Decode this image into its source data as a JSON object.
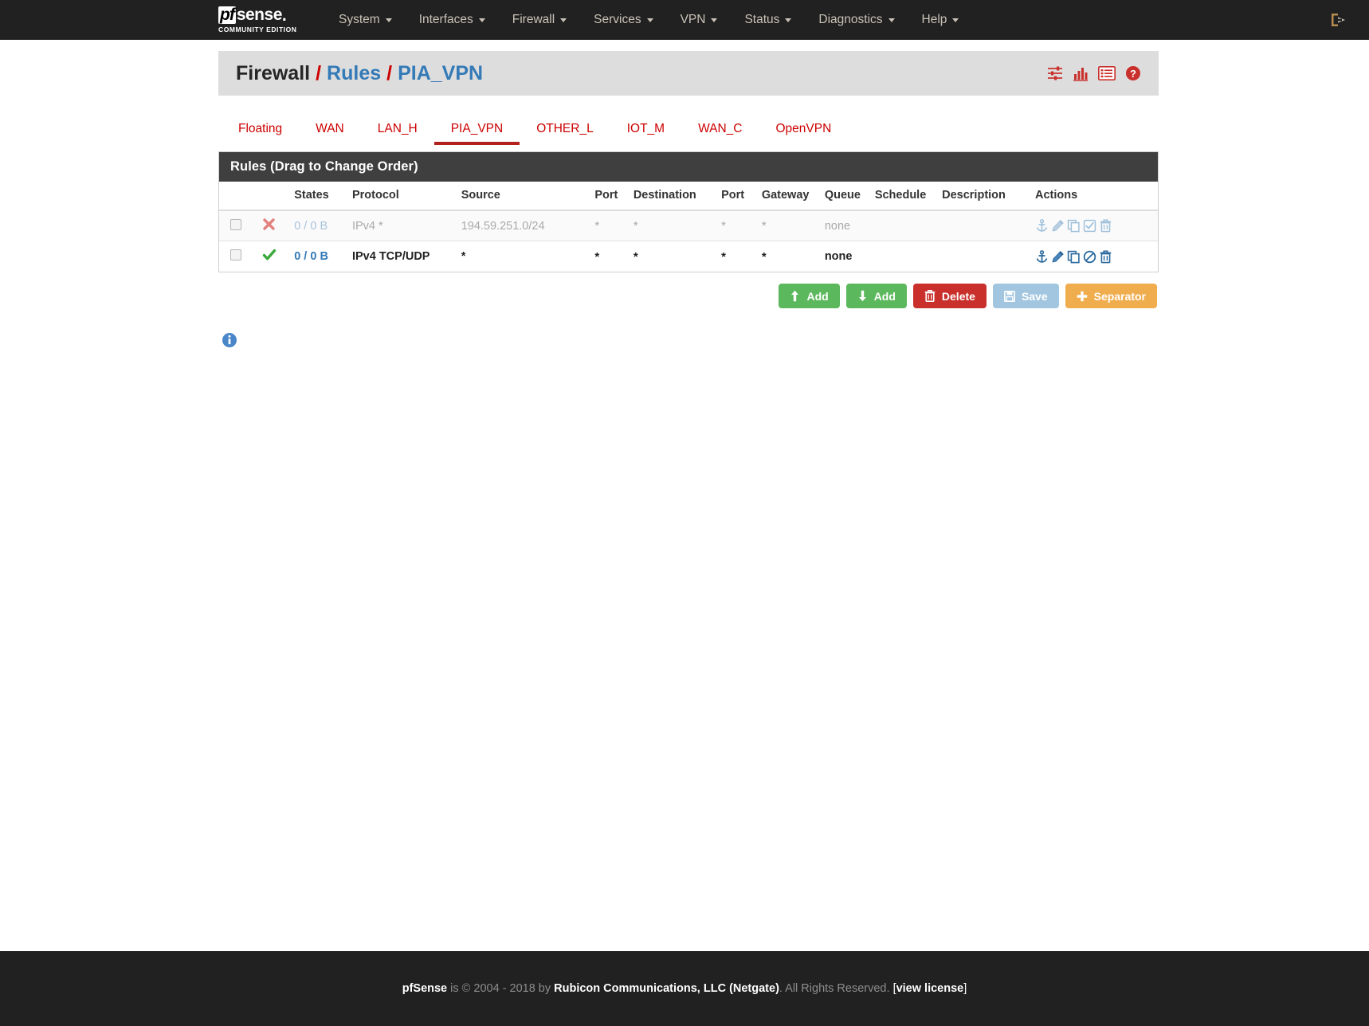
{
  "navbar": {
    "brand": {
      "logo_pf": "pf",
      "logo_sense": "sense",
      "logo_dot": ".",
      "edition": "COMMUNITY EDITION"
    },
    "menu": [
      {
        "label": "System",
        "has_caret": true
      },
      {
        "label": "Interfaces",
        "has_caret": true
      },
      {
        "label": "Firewall",
        "has_caret": true
      },
      {
        "label": "Services",
        "has_caret": true
      },
      {
        "label": "VPN",
        "has_caret": true
      },
      {
        "label": "Status",
        "has_caret": true
      },
      {
        "label": "Diagnostics",
        "has_caret": true
      },
      {
        "label": "Help",
        "has_caret": true
      }
    ],
    "logout_icon": "logout-icon"
  },
  "header": {
    "breadcrumb": {
      "root": "Firewall",
      "sep1": "/",
      "section": "Rules",
      "sep2": "/",
      "current": "PIA_VPN"
    },
    "icons": [
      {
        "name": "filter-sliders-icon"
      },
      {
        "name": "bar-chart-icon"
      },
      {
        "name": "list-table-icon"
      },
      {
        "name": "help-circle-icon"
      }
    ]
  },
  "tabs": [
    {
      "label": "Floating",
      "active": false
    },
    {
      "label": "WAN",
      "active": false
    },
    {
      "label": "LAN_H",
      "active": false
    },
    {
      "label": "PIA_VPN",
      "active": true
    },
    {
      "label": "OTHER_L",
      "active": false
    },
    {
      "label": "IOT_M",
      "active": false
    },
    {
      "label": "WAN_C",
      "active": false
    },
    {
      "label": "OpenVPN",
      "active": false
    }
  ],
  "panel": {
    "title": "Rules (Drag to Change Order)",
    "columns": {
      "checkbox": "",
      "action": "",
      "states": "States",
      "protocol": "Protocol",
      "source": "Source",
      "port": "Port",
      "destination": "Destination",
      "port2": "Port",
      "gateway": "Gateway",
      "queue": "Queue",
      "schedule": "Schedule",
      "description": "Description",
      "actions": "Actions"
    },
    "rows": [
      {
        "enabled": false,
        "action_icon": "block-x-icon",
        "states": "0 / 0 B",
        "protocol": "IPv4 *",
        "source": "194.59.251.0/24",
        "port": "*",
        "destination": "*",
        "port2": "*",
        "gateway": "*",
        "queue": "none",
        "schedule": "",
        "description": "",
        "actions": [
          {
            "name": "anchor-icon"
          },
          {
            "name": "edit-pencil-icon"
          },
          {
            "name": "copy-icon"
          },
          {
            "name": "enable-check-icon"
          },
          {
            "name": "delete-trash-icon"
          }
        ]
      },
      {
        "enabled": true,
        "action_icon": "pass-check-icon",
        "states": "0 / 0 B",
        "protocol": "IPv4 TCP/UDP",
        "source": "*",
        "port": "*",
        "destination": "*",
        "port2": "*",
        "gateway": "*",
        "queue": "none",
        "schedule": "",
        "description": "",
        "actions": [
          {
            "name": "anchor-icon"
          },
          {
            "name": "edit-pencil-icon"
          },
          {
            "name": "copy-icon"
          },
          {
            "name": "disable-ban-icon"
          },
          {
            "name": "delete-trash-icon"
          }
        ]
      }
    ]
  },
  "buttons": [
    {
      "label": "Add",
      "icon": "arrow-up-icon",
      "style": "green"
    },
    {
      "label": "Add",
      "icon": "arrow-down-icon",
      "style": "green"
    },
    {
      "label": "Delete",
      "icon": "trash-icon",
      "style": "red"
    },
    {
      "label": "Save",
      "icon": "floppy-save-icon",
      "style": "blue"
    },
    {
      "label": "Separator",
      "icon": "plus-icon",
      "style": "orange"
    }
  ],
  "info": {
    "icon": "info-circle-icon"
  },
  "footer": {
    "brand": "pfSense",
    "text1": " is © 2004 - 2018 by ",
    "company": "Rubicon Communications, LLC (Netgate)",
    "text2": ". All Rights Reserved. ",
    "bracket_open": "[",
    "license": "view license",
    "bracket_close": "]"
  },
  "colors": {
    "accent_red": "#cc0000",
    "link_blue": "#337ab7",
    "nav_dark": "#212121",
    "panel_dark": "#3f3f3f",
    "green": "#5cb85c",
    "orange": "#f0ad4e"
  }
}
